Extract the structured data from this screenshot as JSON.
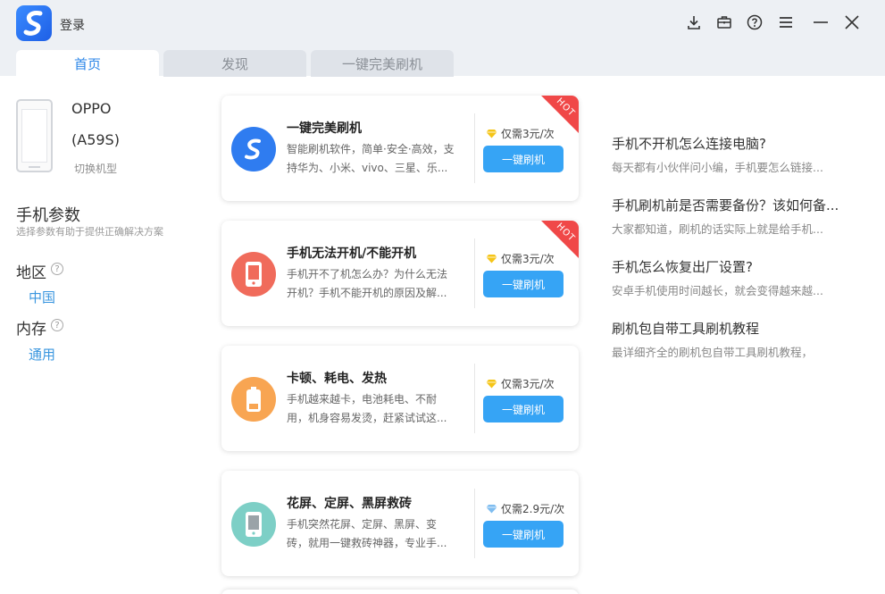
{
  "header": {
    "login_label": "登录"
  },
  "tabs": [
    {
      "label": "首页",
      "active": true
    },
    {
      "label": "发现",
      "active": false
    },
    {
      "label": "一键完美刷机",
      "active": false
    }
  ],
  "device": {
    "brand": "OPPO",
    "model": "(A59S)",
    "switch_label": "切换机型"
  },
  "params": {
    "title": "手机参数",
    "subtitle": "选择参数有助于提供正确解决方案",
    "region_label": "地区",
    "region_value": "中国",
    "memory_label": "内存",
    "memory_value": "通用",
    "help_glyph": "?"
  },
  "cards": [
    {
      "title": "一键完美刷机",
      "desc1": "智能刷机软件，简单·安全·高效，支",
      "desc2": "持华为、小米、vivo、三星、乐...",
      "price": "仅需3元/次",
      "button": "一键刷机",
      "hot": true,
      "hot_label": "HOT",
      "icon": "app-logo-icon",
      "icon_color": "#2f7cf0",
      "gem_color": "#f5c518"
    },
    {
      "title": "手机无法开机/不能开机",
      "desc1": "手机开不了机怎么办？为什么无法",
      "desc2": "开机？手机不能开机的原因及解...",
      "price": "仅需3元/次",
      "button": "一键刷机",
      "hot": true,
      "hot_label": "HOT",
      "icon": "phone-power-icon",
      "icon_color": "#f06b5b",
      "gem_color": "#f5c518"
    },
    {
      "title": "卡顿、耗电、发热",
      "desc1": "手机越来越卡，电池耗电、不耐",
      "desc2": "用，机身容易发烫，赶紧试试这...",
      "price": "仅需3元/次",
      "button": "一键刷机",
      "hot": false,
      "hot_label": "",
      "icon": "battery-icon",
      "icon_color": "#f8a552",
      "gem_color": "#f5c518"
    },
    {
      "title": "花屏、定屏、黑屏救砖",
      "desc1": "手机突然花屏、定屏、黑屏、变",
      "desc2": "砖，就用一键救砖神器，专业手...",
      "price": "仅需2.9元/次",
      "button": "一键刷机",
      "hot": false,
      "hot_label": "",
      "icon": "phone-screen-icon",
      "icon_color": "#7dcfc6",
      "gem_color": "#7fbdf0"
    }
  ],
  "articles": [
    {
      "title": "手机不开机怎么连接电脑?",
      "excerpt": "每天都有小伙伴问小编，手机要怎么链接..."
    },
    {
      "title": "手机刷机前是否需要备份？该如何备...",
      "excerpt": "大家都知道，刷机的话实际上就是给手机..."
    },
    {
      "title": "手机怎么恢复出厂设置?",
      "excerpt": "安卓手机使用时间越长，就会变得越来越..."
    },
    {
      "title": "刷机包自带工具刷机教程",
      "excerpt": "最详细齐全的刷机包自带工具刷机教程，"
    }
  ],
  "colors": {
    "accent": "#2b86e8",
    "button": "#36a4f5",
    "hot": "#f04848"
  }
}
